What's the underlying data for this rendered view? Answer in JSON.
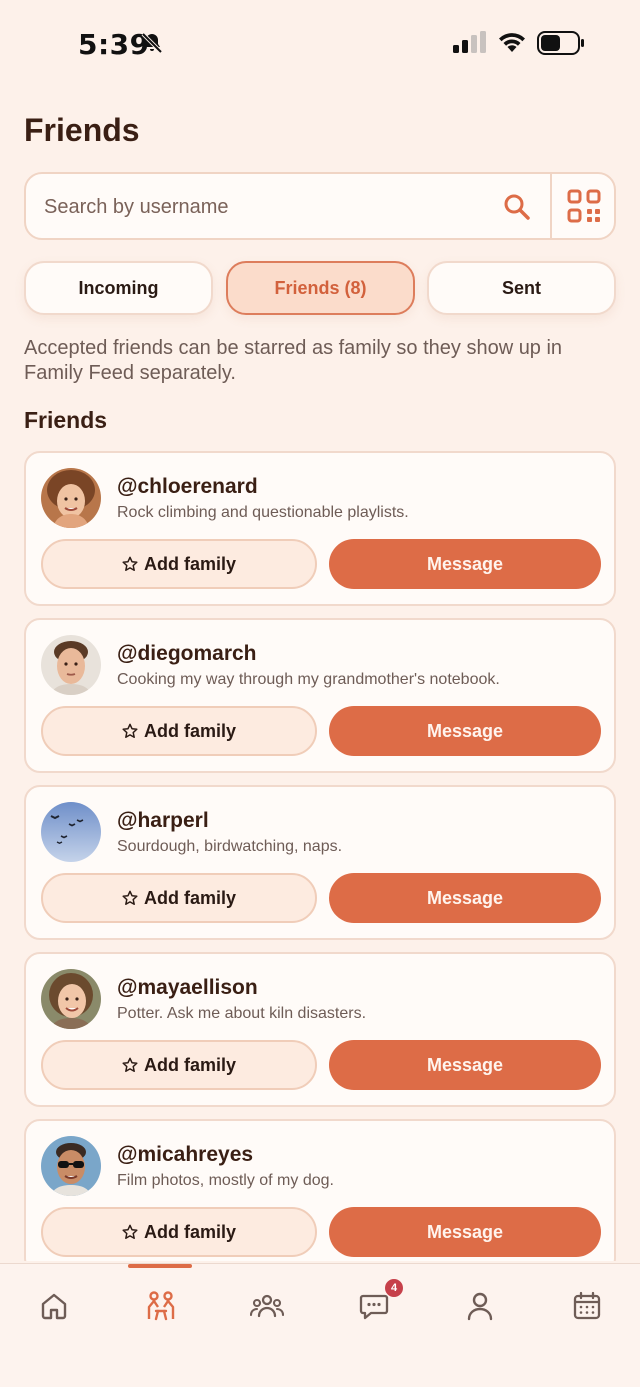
{
  "status_bar": {
    "time": "5:39"
  },
  "header": {
    "title": "Friends"
  },
  "search": {
    "placeholder": "Search by username"
  },
  "tabs": [
    {
      "label": "Incoming",
      "active": false
    },
    {
      "label": "Friends (8)",
      "active": true
    },
    {
      "label": "Sent",
      "active": false
    }
  ],
  "description": "Accepted friends can be starred as family so they show up in Family Feed separately.",
  "section_heading": "Friends",
  "friends": [
    {
      "username": "@chloerenard",
      "bio": "Rock climbing and questionable playlists.",
      "add_family_label": "Add family",
      "message_label": "Message"
    },
    {
      "username": "@diegomarch",
      "bio": "Cooking my way through my grandmother's notebook.",
      "add_family_label": "Add family",
      "message_label": "Message"
    },
    {
      "username": "@harperl",
      "bio": "Sourdough, birdwatching, naps.",
      "add_family_label": "Add family",
      "message_label": "Message"
    },
    {
      "username": "@mayaellison",
      "bio": "Potter. Ask me about kiln disasters.",
      "add_family_label": "Add family",
      "message_label": "Message"
    },
    {
      "username": "@micahreyes",
      "bio": "Film photos, mostly of my dog.",
      "add_family_label": "Add family",
      "message_label": "Message"
    }
  ],
  "bottom_nav": {
    "items": [
      {
        "icon": "home-icon",
        "active": false
      },
      {
        "icon": "friends-icon",
        "active": true
      },
      {
        "icon": "groups-icon",
        "active": false
      },
      {
        "icon": "chat-icon",
        "active": false
      },
      {
        "icon": "profile-icon",
        "active": false
      },
      {
        "icon": "calendar-icon",
        "active": false
      }
    ],
    "chat_badge": "4"
  },
  "colors": {
    "background": "#fdf1ea",
    "accent": "#dd6c47",
    "badge": "#c6404a",
    "card": "#fffbf8"
  }
}
